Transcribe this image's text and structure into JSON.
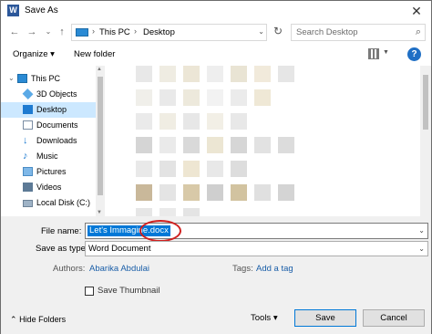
{
  "titlebar": {
    "app_icon_letter": "W",
    "title": "Save As",
    "close_glyph": "✕"
  },
  "address": {
    "crumbs": [
      "This PC",
      "Desktop"
    ],
    "search_placeholder": "Search Desktop"
  },
  "toolbar": {
    "organize_label": "Organize ▾",
    "new_folder_label": "New folder",
    "help_glyph": "?"
  },
  "nav": {
    "items": [
      {
        "label": "This PC",
        "icon": "pc-icon",
        "selected": false
      },
      {
        "label": "3D Objects",
        "icon": "3d-objects-icon",
        "selected": false
      },
      {
        "label": "Desktop",
        "icon": "desktop-icon",
        "selected": true
      },
      {
        "label": "Documents",
        "icon": "documents-icon",
        "selected": false
      },
      {
        "label": "Downloads",
        "icon": "downloads-icon",
        "selected": false
      },
      {
        "label": "Music",
        "icon": "music-icon",
        "selected": false
      },
      {
        "label": "Pictures",
        "icon": "pictures-icon",
        "selected": false
      },
      {
        "label": "Videos",
        "icon": "videos-icon",
        "selected": false
      },
      {
        "label": "Local Disk (C:)",
        "icon": "disk-icon",
        "selected": false
      }
    ]
  },
  "form": {
    "file_name_label": "File name:",
    "file_name_value": "Let's Immagine.docx",
    "save_as_type_label": "Save as type:",
    "save_as_type_value": "Word Document",
    "authors_label": "Authors:",
    "authors_value": "Abarika Abdulai",
    "tags_label": "Tags:",
    "tags_value": "Add a tag",
    "save_thumbnail_label": "Save Thumbnail",
    "save_thumbnail_checked": false
  },
  "footer": {
    "hide_folders_label": "Hide Folders",
    "tools_label": "Tools",
    "save_label": "Save",
    "cancel_label": "Cancel"
  },
  "colors": {
    "accent": "#0078d7",
    "selected_bg": "#cce8ff",
    "annotation_circle": "#d0201f",
    "link": "#1a5ea8"
  }
}
